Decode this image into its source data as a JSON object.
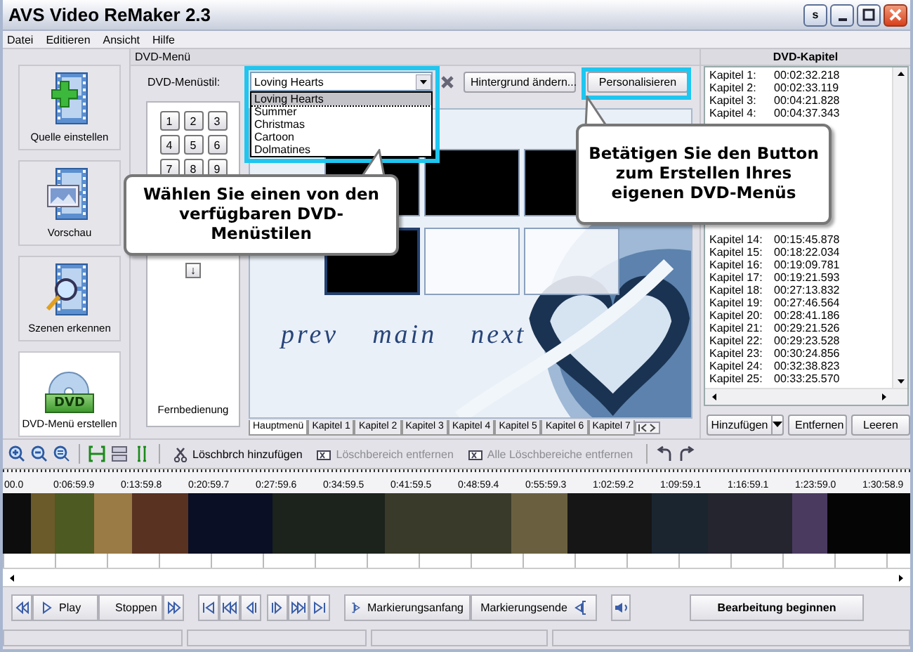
{
  "window": {
    "title": "AVS Video ReMaker 2.3",
    "skin_button": "s"
  },
  "menu": [
    "Datei",
    "Editieren",
    "Ansicht",
    "Hilfe"
  ],
  "sidebar": [
    {
      "label": "Quelle einstellen",
      "kind": "source",
      "selected": false
    },
    {
      "label": "Vorschau",
      "kind": "preview",
      "selected": false
    },
    {
      "label": "Szenen erkennen",
      "kind": "scenes",
      "selected": false
    },
    {
      "label": "DVD-Menü erstellen",
      "kind": "dvd",
      "selected": true,
      "badge": "DVD"
    }
  ],
  "dvd_menu": {
    "title": "DVD-Menü",
    "style_label": "DVD-Menüstil:",
    "style_value": "Loving Hearts",
    "expanded": true,
    "style_options": [
      {
        "label": "Loving Hearts",
        "selected": true
      },
      {
        "label": "Summer",
        "selected": false
      },
      {
        "label": "Christmas",
        "selected": false
      },
      {
        "label": "Cartoon",
        "selected": false
      },
      {
        "label": "Dolmatines",
        "selected": false
      }
    ],
    "background_button": "Hintergrund ändern...",
    "customize_button": "Personalisieren",
    "remote": {
      "keys": [
        "1",
        "2",
        "3",
        "4",
        "5",
        "6",
        "7",
        "8",
        "9"
      ],
      "down_key": "↓",
      "label": "Fernbedienung"
    },
    "preview": {
      "thumbnails": [
        {
          "kind": "dark",
          "selected": false
        },
        {
          "kind": "dark",
          "selected": false
        },
        {
          "kind": "dark",
          "selected": false
        },
        {
          "kind": "dark",
          "selected": true
        },
        {
          "kind": "light",
          "selected": false
        },
        {
          "kind": "light",
          "selected": false
        }
      ],
      "nav_labels": [
        "prev",
        "main",
        "next"
      ]
    },
    "tabs": [
      {
        "label": "Hauptmenü",
        "selected": true
      },
      {
        "label": "Kapitel 1",
        "selected": false
      },
      {
        "label": "Kapitel 2",
        "selected": false
      },
      {
        "label": "Kapitel 3",
        "selected": false
      },
      {
        "label": "Kapitel 4",
        "selected": false
      },
      {
        "label": "Kapitel 5",
        "selected": false
      },
      {
        "label": "Kapitel 6",
        "selected": false
      },
      {
        "label": "Kapitel 7",
        "selected": false
      }
    ]
  },
  "chapters": {
    "title": "DVD-Kapitel",
    "groups": [
      [
        {
          "label": "Kapitel 1:",
          "time": "00:02:32.218"
        },
        {
          "label": "Kapitel 2:",
          "time": "00:02:33.119"
        },
        {
          "label": "Kapitel 3:",
          "time": "00:04:21.828"
        },
        {
          "label": "Kapitel 4:",
          "time": "00:04:37.343"
        }
      ],
      [
        {
          "label": "Kapitel 14:",
          "time": "00:15:45.878"
        },
        {
          "label": "Kapitel 15:",
          "time": "00:18:22.034"
        },
        {
          "label": "Kapitel 16:",
          "time": "00:19:09.781"
        },
        {
          "label": "Kapitel 17:",
          "time": "00:19:21.593"
        },
        {
          "label": "Kapitel 18:",
          "time": "00:27:13.832"
        },
        {
          "label": "Kapitel 19:",
          "time": "00:27:46.564"
        },
        {
          "label": "Kapitel 20:",
          "time": "00:28:41.186"
        },
        {
          "label": "Kapitel 21:",
          "time": "00:29:21.526"
        },
        {
          "label": "Kapitel 22:",
          "time": "00:29:23.528"
        },
        {
          "label": "Kapitel 23:",
          "time": "00:30:24.856"
        },
        {
          "label": "Kapitel 24:",
          "time": "00:32:38.823"
        },
        {
          "label": "Kapitel 25:",
          "time": "00:33:25.570"
        }
      ]
    ],
    "add_button": "Hinzufügen",
    "remove_button": "Entfernen",
    "clear_button": "Leeren"
  },
  "timeline": {
    "edit_actions": [
      {
        "label": "Löschbrch hinzufügen",
        "disabled": false
      },
      {
        "label": "Löschbereich entfernen",
        "disabled": true
      },
      {
        "label": "Alle Löschbereiche entfernen",
        "disabled": true
      }
    ],
    "ruler_labels": [
      "00.0",
      "0:06:59.9",
      "0:13:59.8",
      "0:20:59.7",
      "0:27:59.6",
      "0:34:59.5",
      "0:41:59.5",
      "0:48:59.4",
      "0:55:59.3",
      "1:02:59.2",
      "1:09:59.1",
      "1:16:59.1",
      "1:23:59.0",
      "1:30:58.9"
    ]
  },
  "transport": {
    "play": "Play",
    "stop": "Stoppen",
    "mark_in": "Markierungsanfang",
    "mark_out": "Markierungsende",
    "start": "Bearbeitung beginnen"
  },
  "callouts": [
    "Wählen Sie einen von den verfügbaren DVD-Menüstilen",
    "Betätigen Sie den Button zum Erstellen Ihres eigenen DVD-Menüs"
  ]
}
